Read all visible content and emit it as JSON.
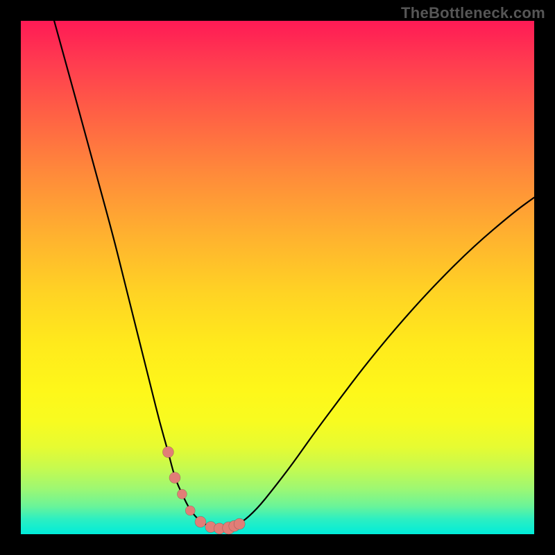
{
  "watermark": "TheBottleneck.com",
  "colors": {
    "frame_bg": "#000000",
    "watermark_text": "#565656",
    "curve_stroke": "#000000",
    "marker_fill": "#e17e77",
    "gradient_top": "#ff1a55",
    "gradient_bottom": "#00ecda"
  },
  "chart_data": {
    "type": "line",
    "title": "",
    "xlabel": "",
    "ylabel": "",
    "xlim": [
      0,
      100
    ],
    "ylim": [
      0,
      100
    ],
    "grid": false,
    "legend": false,
    "note": "No numeric axes are shown; values below are pixel-read estimates expressed as 0–100 percent of the plot area (x left→right, y bottom→top).",
    "series": [
      {
        "name": "curve",
        "x": [
          6.5,
          9,
          12,
          15,
          18,
          20,
          22,
          24,
          25.5,
          27,
          28.7,
          30,
          31.4,
          33,
          35,
          37,
          38.7,
          40.5,
          43,
          46,
          49,
          53,
          57,
          62,
          67,
          73,
          80,
          88,
          96,
          100
        ],
        "y": [
          100,
          91,
          80,
          69,
          58,
          50,
          42,
          34,
          28,
          22,
          16,
          11,
          7.8,
          4.6,
          2.4,
          1.4,
          1.1,
          1.2,
          2.2,
          4.9,
          8.6,
          13.8,
          19.5,
          26.2,
          32.8,
          40.1,
          47.9,
          55.9,
          62.7,
          65.6
        ]
      }
    ],
    "markers": {
      "name": "near-minimum points",
      "x": [
        28.7,
        30.0,
        31.4,
        33.0,
        35.0,
        37.0,
        38.7,
        40.5,
        41.6,
        42.6
      ],
      "y": [
        16.0,
        11.0,
        7.8,
        4.6,
        2.4,
        1.4,
        1.1,
        1.2,
        1.6,
        2.0
      ],
      "r": [
        8,
        8,
        7,
        7,
        8,
        8,
        8,
        9,
        8,
        8
      ]
    }
  }
}
